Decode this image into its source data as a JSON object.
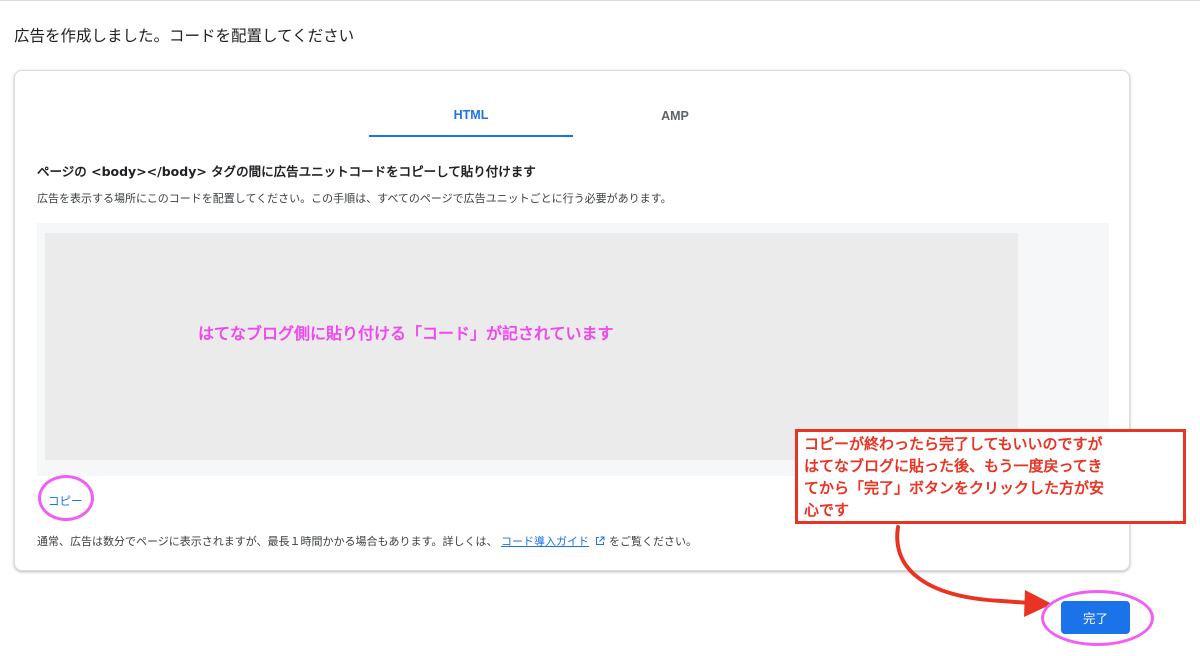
{
  "page": {
    "title": "広告を作成しました。コードを配置してください"
  },
  "tabs": [
    {
      "label": "HTML",
      "active": true
    },
    {
      "label": "AMP",
      "active": false
    }
  ],
  "content": {
    "heading": "ページの <body></body> タグの間に広告ユニットコードをコピーして貼り付けます",
    "description": "広告を表示する場所にこのコードを配置してください。この手順は、すべてのページで広告ユニットごとに行う必要があります。",
    "code_overlay_note": "はてなブログ側に貼り付ける「コード」が記されています",
    "copy_label": "コピー",
    "footer_before": "通常、広告は数分でページに表示されますが、最長１時間かかる場合もあります。詳しくは、",
    "footer_link": "コード導入ガイド",
    "footer_after": "をご覧ください。"
  },
  "callout": {
    "lines": [
      "コピーが終わったら完了してもいいのですが",
      "はてなブログに貼った後、もう一度戻ってき",
      "てから「完了」ボタンをクリックした方が安",
      "心です"
    ]
  },
  "actions": {
    "done_label": "完了"
  },
  "colors": {
    "accent": "#1a73e8",
    "annotation_pink": "#f047f0",
    "annotation_red": "#ea3323",
    "code_background": "#ebebeb"
  },
  "icons": {
    "external_link": "open-in-new-icon"
  }
}
